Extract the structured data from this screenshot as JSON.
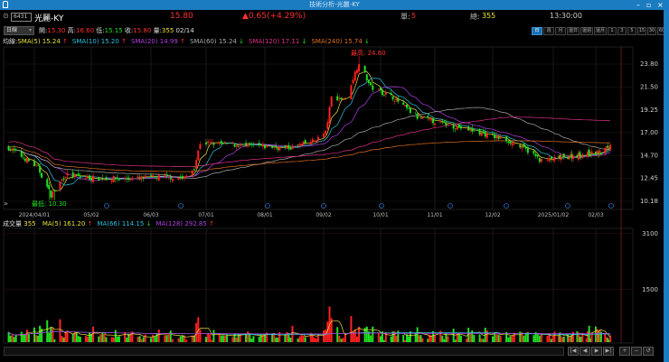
{
  "window": {
    "title": "技術分析-光麗-KY"
  },
  "header": {
    "code": "6431",
    "name": "光麗-KY",
    "price": "15.80",
    "change": "▲0.65(+4.29%)",
    "single_label": "單:",
    "single": "5",
    "total_label": "總:",
    "total": "355",
    "time": "13:30:00"
  },
  "ohlc": {
    "period": "日線",
    "open_label": "開:",
    "open": "15.30",
    "high_label": "高:",
    "high": "16.60",
    "low_label": "低:",
    "low": "15.15",
    "close_label": "收:",
    "close": "15.80",
    "vol_label": "量:",
    "vol": "355",
    "date": "02/14"
  },
  "period_buttons": [
    "日",
    "週",
    "月",
    "還日",
    "還週",
    "還月",
    "1",
    "3",
    "5",
    "15",
    "30",
    "60"
  ],
  "ma_legend": {
    "prefix": "均線:",
    "items": [
      {
        "label": "SMA(5) 15.24",
        "arrow": "↑",
        "color": "#e8e040",
        "arrow_color": "#ff3030"
      },
      {
        "label": "SMA(10) 15.20",
        "arrow": "↑",
        "color": "#30c0e0",
        "arrow_color": "#ff3030"
      },
      {
        "label": "SMA(20) 14.99",
        "arrow": "↑",
        "color": "#b040e0",
        "arrow_color": "#ff3030"
      },
      {
        "label": "SMA(60) 15.24",
        "arrow": "↓",
        "color": "#a8a8a8",
        "arrow_color": "#20e020"
      },
      {
        "label": "SMA(120) 17.11",
        "arrow": "↓",
        "color": "#e0308a",
        "arrow_color": "#20e020"
      },
      {
        "label": "SMA(240) 15.74",
        "arrow": "↓",
        "color": "#e07020",
        "arrow_color": "#20e020"
      }
    ]
  },
  "vol_legend": {
    "prefix": "成交量",
    "value": "355",
    "items": [
      {
        "label": "MA(5) 161.20",
        "arrow": "↑",
        "color": "#e8e040",
        "arrow_color": "#ff3030"
      },
      {
        "label": "MA(66) 114.15",
        "arrow": "↓",
        "color": "#30c0e0",
        "arrow_color": "#20e020"
      },
      {
        "label": "MA(128) 292.85",
        "arrow": "↑",
        "color": "#b040e0",
        "arrow_color": "#ff3030"
      }
    ]
  },
  "annotations": {
    "high": "最高: 24.60",
    "low": "最低: 10.30"
  },
  "chart_data": {
    "type": "candlestick",
    "x_ticks": [
      "2024/04/01",
      "05/02",
      "06/03",
      "07/01",
      "08/01",
      "09/02",
      "10/01",
      "11/01",
      "12/02",
      "2025/01/02",
      "02/03"
    ],
    "price_ticks": [
      "23.80",
      "21.50",
      "19.25",
      "17.00",
      "14.70",
      "12.45",
      "10.18"
    ],
    "volume_ticks": [
      "3100",
      "1500"
    ],
    "close_anchors": [
      [
        "2024-03-18",
        15.5
      ],
      [
        "2024-03-28",
        14.3
      ],
      [
        "2024-04-03",
        13.5
      ],
      [
        "2024-04-10",
        10.8
      ],
      [
        "2024-04-18",
        12.8
      ],
      [
        "2024-05-01",
        12.5
      ],
      [
        "2024-05-20",
        12.4
      ],
      [
        "2024-06-10",
        12.6
      ],
      [
        "2024-06-20",
        12.5
      ],
      [
        "2024-06-25",
        13.5
      ],
      [
        "2024-06-28",
        16
      ],
      [
        "2024-07-15",
        15.8
      ],
      [
        "2024-08-01",
        15.6
      ],
      [
        "2024-08-15",
        15.5
      ],
      [
        "2024-08-28",
        16.2
      ],
      [
        "2024-09-03",
        17
      ],
      [
        "2024-09-06",
        20.5
      ],
      [
        "2024-09-13",
        20.3
      ],
      [
        "2024-09-20",
        24
      ],
      [
        "2024-09-26",
        21.5
      ],
      [
        "2024-10-08",
        20.5
      ],
      [
        "2024-10-22",
        18.5
      ],
      [
        "2024-11-08",
        17.8
      ],
      [
        "2024-11-25",
        17.0
      ],
      [
        "2024-12-10",
        16.2
      ],
      [
        "2024-12-20",
        15.2
      ],
      [
        "2024-12-27",
        14.2
      ],
      [
        "2025-01-08",
        14.5
      ],
      [
        "2025-01-22",
        14.8
      ],
      [
        "2025-02-07",
        15.0
      ],
      [
        "2025-02-14",
        15.8
      ]
    ],
    "high": 24.6,
    "low": 10.3,
    "up_color": "#ff2020",
    "down_color": "#20e020"
  }
}
